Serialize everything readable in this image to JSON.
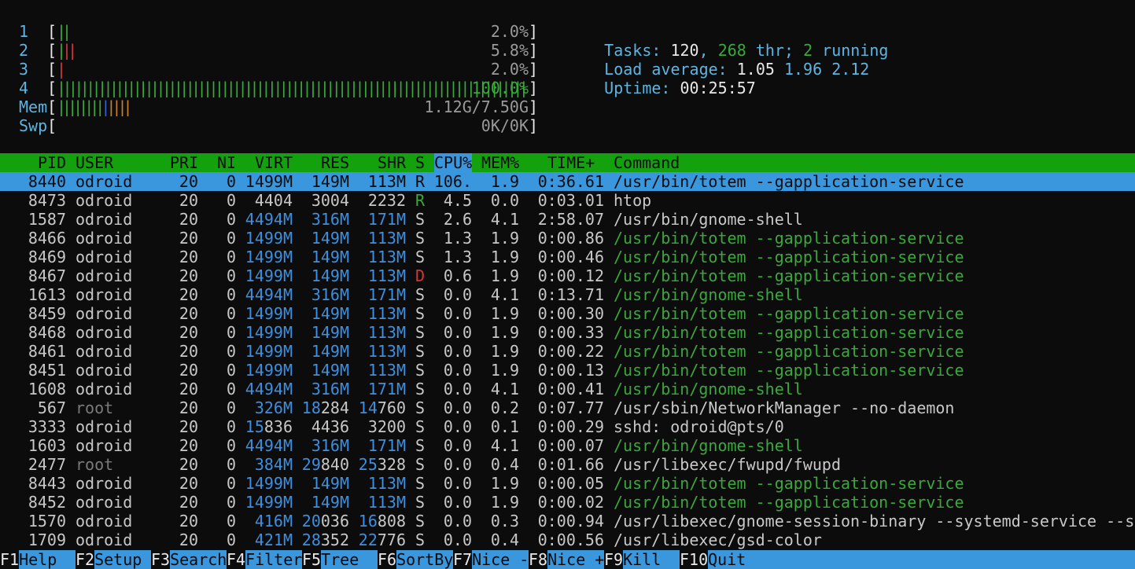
{
  "meters": [
    {
      "label": "1",
      "value": "2.0%",
      "bars": [
        {
          "text": "||",
          "color": "green"
        }
      ]
    },
    {
      "label": "2",
      "value": "5.8%",
      "bars": [
        {
          "text": "|",
          "color": "green"
        },
        {
          "text": "||",
          "color": "red"
        }
      ]
    },
    {
      "label": "3",
      "value": "2.0%",
      "bars": [
        {
          "text": "|",
          "color": "red"
        }
      ]
    },
    {
      "label": "4",
      "value": "100.0%",
      "bars": [
        {
          "text": "||||||||||||||||||||||||||||||||||||||||||||||||||||||||||||||||||||||||||||||||",
          "color": "green"
        }
      ]
    },
    {
      "label": "Mem",
      "value": "1.12G/7.50G",
      "bars": [
        {
          "text": "||||||||",
          "color": "green"
        },
        {
          "text": "|",
          "color": "dblue"
        },
        {
          "text": "||||",
          "color": "orange"
        }
      ]
    },
    {
      "label": "Swp",
      "value": "0K/0K",
      "bars": []
    }
  ],
  "summary": {
    "tasks_label": "Tasks: ",
    "tasks_count": "120",
    "tasks_sep": ", ",
    "threads": "268",
    "threads_label": " thr; ",
    "running_count": "2",
    "running_label": " running",
    "load_label": "Load average: ",
    "load1": "1.05",
    "load5": "1.96",
    "load15": "2.12",
    "uptime_label": "Uptime: ",
    "uptime": "00:25:57"
  },
  "columns": {
    "pid": "PID",
    "user": "USER",
    "pri": "PRI",
    "ni": "NI",
    "virt": "VIRT",
    "res": "RES",
    "shr": "SHR",
    "s": "S",
    "cpu": "CPU%",
    "mem": "MEM%",
    "time": "TIME+",
    "command": "Command"
  },
  "processes": [
    {
      "pid": "8440",
      "user": "odroid",
      "pri": "20",
      "ni": "0",
      "virt": "1499M",
      "res": "149M",
      "shr": "113M",
      "s": "R",
      "cpu": "106.",
      "mem": "1.9",
      "time": "0:36.61",
      "command": "/usr/bin/totem --gapplication-service",
      "selected": true,
      "thread": false
    },
    {
      "pid": "8473",
      "user": "odroid",
      "pri": "20",
      "ni": "0",
      "virt": "4404",
      "res": "3004",
      "shr": "2232",
      "s": "R",
      "cpu": "4.5",
      "mem": "0.0",
      "time": "0:03.01",
      "command": "htop",
      "thread": false
    },
    {
      "pid": "1587",
      "user": "odroid",
      "pri": "20",
      "ni": "0",
      "virt": "4494M",
      "res": "316M",
      "shr": "171M",
      "s": "S",
      "cpu": "2.6",
      "mem": "4.1",
      "time": "2:58.07",
      "command": "/usr/bin/gnome-shell",
      "thread": false
    },
    {
      "pid": "8466",
      "user": "odroid",
      "pri": "20",
      "ni": "0",
      "virt": "1499M",
      "res": "149M",
      "shr": "113M",
      "s": "S",
      "cpu": "1.3",
      "mem": "1.9",
      "time": "0:00.86",
      "command": "/usr/bin/totem --gapplication-service",
      "thread": true
    },
    {
      "pid": "8469",
      "user": "odroid",
      "pri": "20",
      "ni": "0",
      "virt": "1499M",
      "res": "149M",
      "shr": "113M",
      "s": "S",
      "cpu": "1.3",
      "mem": "1.9",
      "time": "0:00.46",
      "command": "/usr/bin/totem --gapplication-service",
      "thread": true
    },
    {
      "pid": "8467",
      "user": "odroid",
      "pri": "20",
      "ni": "0",
      "virt": "1499M",
      "res": "149M",
      "shr": "113M",
      "s": "D",
      "cpu": "0.6",
      "mem": "1.9",
      "time": "0:00.12",
      "command": "/usr/bin/totem --gapplication-service",
      "thread": true
    },
    {
      "pid": "1613",
      "user": "odroid",
      "pri": "20",
      "ni": "0",
      "virt": "4494M",
      "res": "316M",
      "shr": "171M",
      "s": "S",
      "cpu": "0.0",
      "mem": "4.1",
      "time": "0:13.71",
      "command": "/usr/bin/gnome-shell",
      "thread": true
    },
    {
      "pid": "8459",
      "user": "odroid",
      "pri": "20",
      "ni": "0",
      "virt": "1499M",
      "res": "149M",
      "shr": "113M",
      "s": "S",
      "cpu": "0.0",
      "mem": "1.9",
      "time": "0:00.30",
      "command": "/usr/bin/totem --gapplication-service",
      "thread": true
    },
    {
      "pid": "8468",
      "user": "odroid",
      "pri": "20",
      "ni": "0",
      "virt": "1499M",
      "res": "149M",
      "shr": "113M",
      "s": "S",
      "cpu": "0.0",
      "mem": "1.9",
      "time": "0:00.33",
      "command": "/usr/bin/totem --gapplication-service",
      "thread": true
    },
    {
      "pid": "8461",
      "user": "odroid",
      "pri": "20",
      "ni": "0",
      "virt": "1499M",
      "res": "149M",
      "shr": "113M",
      "s": "S",
      "cpu": "0.0",
      "mem": "1.9",
      "time": "0:00.22",
      "command": "/usr/bin/totem --gapplication-service",
      "thread": true
    },
    {
      "pid": "8451",
      "user": "odroid",
      "pri": "20",
      "ni": "0",
      "virt": "1499M",
      "res": "149M",
      "shr": "113M",
      "s": "S",
      "cpu": "0.0",
      "mem": "1.9",
      "time": "0:00.13",
      "command": "/usr/bin/totem --gapplication-service",
      "thread": true
    },
    {
      "pid": "1608",
      "user": "odroid",
      "pri": "20",
      "ni": "0",
      "virt": "4494M",
      "res": "316M",
      "shr": "171M",
      "s": "S",
      "cpu": "0.0",
      "mem": "4.1",
      "time": "0:00.41",
      "command": "/usr/bin/gnome-shell",
      "thread": true
    },
    {
      "pid": "567",
      "user": "root",
      "pri": "20",
      "ni": "0",
      "virt": "326M",
      "res": "18284",
      "shr": "14760",
      "s": "S",
      "cpu": "0.0",
      "mem": "0.2",
      "time": "0:07.77",
      "command": "/usr/sbin/NetworkManager --no-daemon",
      "thread": false
    },
    {
      "pid": "3333",
      "user": "odroid",
      "pri": "20",
      "ni": "0",
      "virt": "15836",
      "res": "4436",
      "shr": "3200",
      "s": "S",
      "cpu": "0.0",
      "mem": "0.1",
      "time": "0:00.29",
      "command": "sshd: odroid@pts/0",
      "thread": false
    },
    {
      "pid": "1603",
      "user": "odroid",
      "pri": "20",
      "ni": "0",
      "virt": "4494M",
      "res": "316M",
      "shr": "171M",
      "s": "S",
      "cpu": "0.0",
      "mem": "4.1",
      "time": "0:00.07",
      "command": "/usr/bin/gnome-shell",
      "thread": true
    },
    {
      "pid": "2477",
      "user": "root",
      "pri": "20",
      "ni": "0",
      "virt": "384M",
      "res": "29840",
      "shr": "25328",
      "s": "S",
      "cpu": "0.0",
      "mem": "0.4",
      "time": "0:01.66",
      "command": "/usr/libexec/fwupd/fwupd",
      "thread": false
    },
    {
      "pid": "8443",
      "user": "odroid",
      "pri": "20",
      "ni": "0",
      "virt": "1499M",
      "res": "149M",
      "shr": "113M",
      "s": "S",
      "cpu": "0.0",
      "mem": "1.9",
      "time": "0:00.05",
      "command": "/usr/bin/totem --gapplication-service",
      "thread": true
    },
    {
      "pid": "8452",
      "user": "odroid",
      "pri": "20",
      "ni": "0",
      "virt": "1499M",
      "res": "149M",
      "shr": "113M",
      "s": "S",
      "cpu": "0.0",
      "mem": "1.9",
      "time": "0:00.02",
      "command": "/usr/bin/totem --gapplication-service",
      "thread": true
    },
    {
      "pid": "1570",
      "user": "odroid",
      "pri": "20",
      "ni": "0",
      "virt": "416M",
      "res": "20036",
      "shr": "16808",
      "s": "S",
      "cpu": "0.0",
      "mem": "0.3",
      "time": "0:00.94",
      "command": "/usr/libexec/gnome-session-binary --systemd-service --s",
      "thread": false
    },
    {
      "pid": "1709",
      "user": "odroid",
      "pri": "20",
      "ni": "0",
      "virt": "421M",
      "res": "28352",
      "shr": "22776",
      "s": "S",
      "cpu": "0.0",
      "mem": "0.4",
      "time": "0:00.56",
      "command": "/usr/libexec/gsd-color",
      "thread": false
    }
  ],
  "fkeys": [
    {
      "key": "F1",
      "label": "Help"
    },
    {
      "key": "F2",
      "label": "Setup"
    },
    {
      "key": "F3",
      "label": "Search"
    },
    {
      "key": "F4",
      "label": "Filter"
    },
    {
      "key": "F5",
      "label": "Tree"
    },
    {
      "key": "F6",
      "label": "SortBy"
    },
    {
      "key": "F7",
      "label": "Nice -"
    },
    {
      "key": "F8",
      "label": "Nice +"
    },
    {
      "key": "F9",
      "label": "Kill"
    },
    {
      "key": "F10",
      "label": "Quit"
    }
  ],
  "colors": {
    "background": "#0c0c0c",
    "header_bg": "#13a10e",
    "selection_bg": "#3a96dd",
    "cyan": "#5fb4e0",
    "green": "#3aa83a",
    "red": "#d03838",
    "blue": "#3d8fdf"
  }
}
